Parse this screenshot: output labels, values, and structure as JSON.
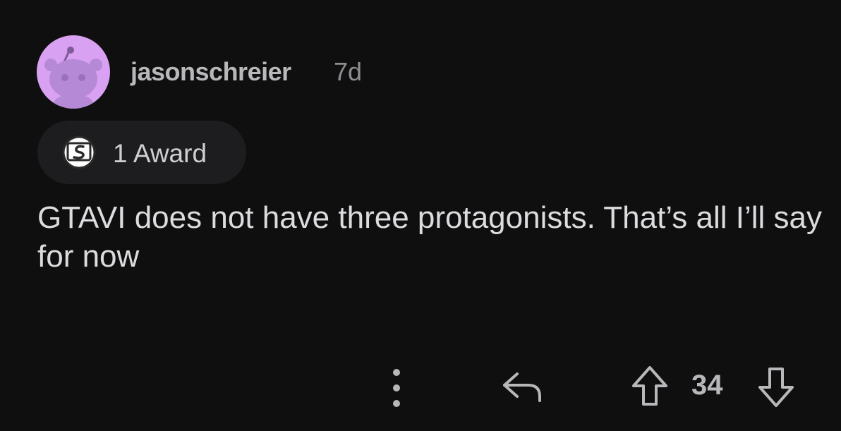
{
  "comment": {
    "username": "jasonschreier",
    "timestamp": "7d",
    "award_label": "1 Award",
    "body": "GTAVI does not have three protagonists. That’s all I’ll say for now",
    "vote_count": "34"
  },
  "actions": {
    "more_icon": "more-vertical-icon",
    "reply_icon": "reply-icon",
    "upvote_icon": "upvote-arrow-icon",
    "downvote_icon": "downvote-arrow-icon"
  },
  "colors": {
    "background": "#0f0f10",
    "avatar_bg": "#d9a1f2",
    "avatar_figure": "#b689d6",
    "pill_bg": "#1d1d1f",
    "text_primary": "#dcdcdf",
    "text_secondary": "#b8b8bb"
  }
}
